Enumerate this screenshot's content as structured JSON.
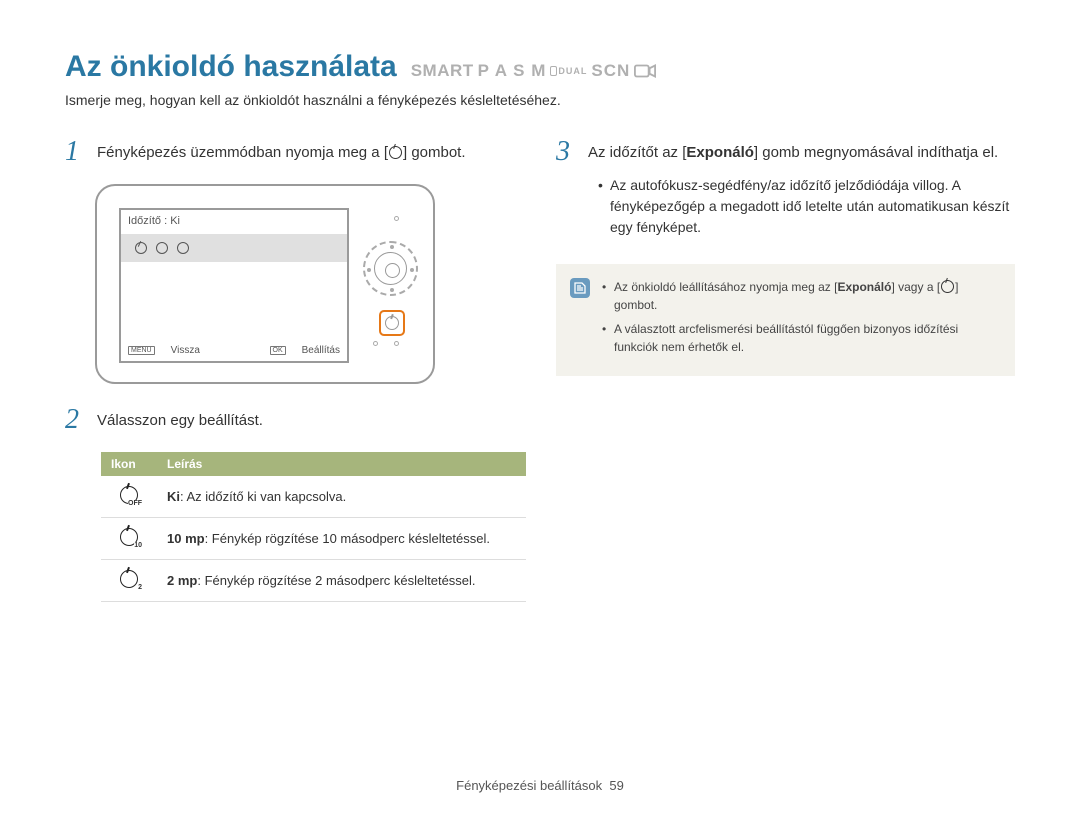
{
  "header": {
    "title": "Az önkioldó használata",
    "modes_smart": "SMART",
    "modes_letters": "P A S M",
    "modes_dual": "DUAL",
    "modes_scn": "SCN",
    "subtitle": "Ismerje meg, hogyan kell az önkioldót használni a fényképezés késleltetéséhez."
  },
  "left": {
    "step1_num": "1",
    "step1_text_a": "Fényképezés üzemmódban nyomja meg a [",
    "step1_text_b": "] gombot.",
    "lcd_top": "Időzítő : Ki",
    "lcd_back_badge": "MENU",
    "lcd_back": "Vissza",
    "lcd_ok_badge": "OK",
    "lcd_set": "Beállítás",
    "step2_num": "2",
    "step2_text": "Válasszon egy beállítást.",
    "table": {
      "head_icon": "Ikon",
      "head_desc": "Leírás",
      "rows": [
        {
          "sub": "OFF",
          "bold": "Ki",
          "text": ": Az időzítő ki van kapcsolva."
        },
        {
          "sub": "10",
          "bold": "10 mp",
          "text": ": Fénykép rögzítése 10 másodperc késleltetéssel."
        },
        {
          "sub": "2",
          "bold": "2 mp",
          "text": ": Fénykép rögzítése 2 másodperc késleltetéssel."
        }
      ]
    }
  },
  "right": {
    "step3_num": "3",
    "step3_text_a": "Az időzítőt az [",
    "step3_bold": "Exponáló",
    "step3_text_b": "] gomb megnyomásával indíthatja el.",
    "bullets": [
      "Az autofókusz-segédfény/az időzítő jelződiódája villog. A fényképezőgép a megadott idő letelte után automatikusan készít egy fényképet."
    ],
    "note": {
      "items_a1": "Az önkioldó leállításához nyomja meg az [",
      "items_a_bold": "Exponáló",
      "items_a2": "] vagy a [",
      "items_a3": "] gombot.",
      "items_b": "A választott arcfelismerési beállítástól függően bizonyos időzítési funkciók nem érhetők el."
    }
  },
  "footer": {
    "section": "Fényképezési beállítások",
    "page": "59"
  }
}
